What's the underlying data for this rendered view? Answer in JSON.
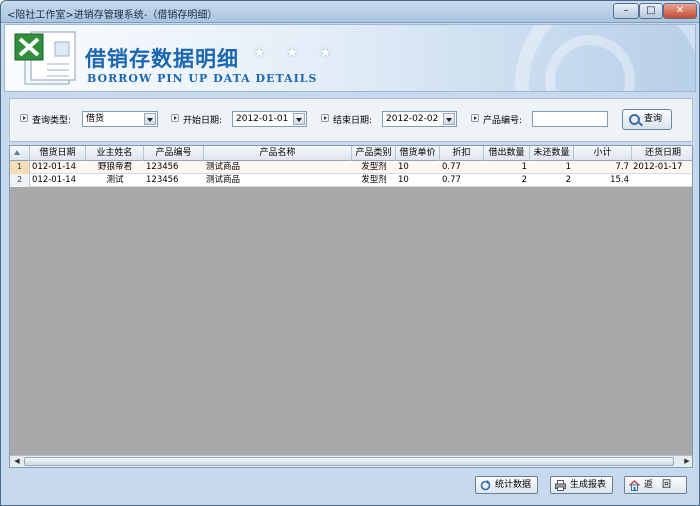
{
  "window": {
    "title": "<陪社工作室>进销存管理系统-（借销存明细）",
    "min_label": "–",
    "max_label": "□",
    "close_label": "✕"
  },
  "banner": {
    "title": "借销存数据明细",
    "stars": "★ ★ ★",
    "subtitle": "BORROW PIN UP DATA DETAILS"
  },
  "query": {
    "type_label": "查询类型:",
    "type_value": "借货",
    "start_label": "开始日期:",
    "start_value": "2012-01-01",
    "end_label": "结束日期:",
    "end_value": "2012-02-02",
    "product_label": "产品编号:",
    "product_value": "",
    "search_button": "查询"
  },
  "table": {
    "columns": [
      "借货日期",
      "业主姓名",
      "产品编号",
      "产品名称",
      "产品类别",
      "借货单价",
      "折扣",
      "借出数量",
      "未还数量",
      "小计",
      "还货日期"
    ],
    "rows": [
      {
        "index": "1",
        "date": "012-01-14",
        "owner": "野狼帝君",
        "code": "123456",
        "name": "测试商品",
        "category": "发型剂",
        "price": "10",
        "discount": "0.77",
        "lent": "1",
        "unreturned": "1",
        "subtotal": "7.7",
        "return_date": "2012-01-17"
      },
      {
        "index": "2",
        "date": "012-01-14",
        "owner": "测试",
        "code": "123456",
        "name": "测试商品",
        "category": "发型剂",
        "price": "10",
        "discount": "0.77",
        "lent": "2",
        "unreturned": "2",
        "subtotal": "15.4",
        "return_date": ""
      }
    ]
  },
  "buttons": {
    "stats": "统计数据",
    "report": "生成报表",
    "back": "返　回"
  },
  "colors": {
    "accent": "#1b67b3",
    "background": "#c7d9ec",
    "grid_empty": "#a9a9a9"
  }
}
